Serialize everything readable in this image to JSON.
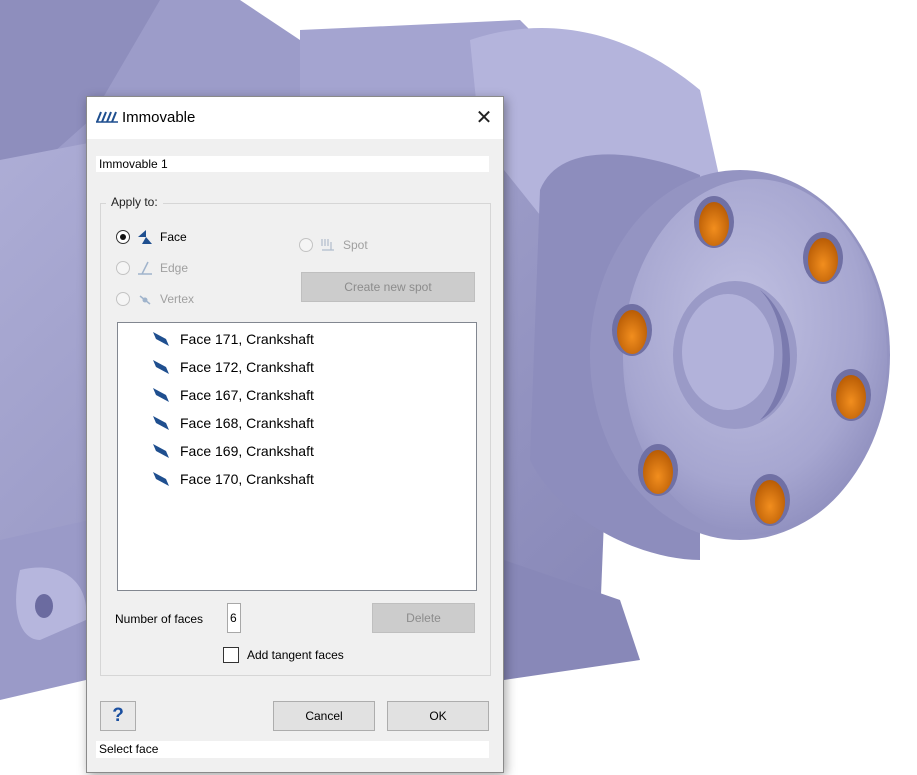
{
  "dialog": {
    "title": "Immovable",
    "close_glyph": "✕",
    "name_value": "Immovable 1",
    "apply_to": {
      "legend": "Apply to:",
      "options": [
        {
          "label": "Face",
          "checked": true,
          "enabled": true,
          "icon": "face-icon"
        },
        {
          "label": "Edge",
          "checked": false,
          "enabled": false,
          "icon": "edge-icon"
        },
        {
          "label": "Vertex",
          "checked": false,
          "enabled": false,
          "icon": "vertex-icon"
        },
        {
          "label": "Spot",
          "checked": false,
          "enabled": false,
          "icon": "spot-icon"
        }
      ],
      "create_spot_label": "Create new spot"
    },
    "faces": [
      "Face 171, Crankshaft",
      "Face 172, Crankshaft",
      "Face 167, Crankshaft",
      "Face 168, Crankshaft",
      "Face 169, Crankshaft",
      "Face 170, Crankshaft"
    ],
    "count_label": "Number of faces",
    "count_value": "6",
    "delete_label": "Delete",
    "tangent_label": "Add tangent faces",
    "tangent_checked": false,
    "help_glyph": "?",
    "cancel_label": "Cancel",
    "ok_label": "OK",
    "status_text": "Select face"
  },
  "colors": {
    "part_body": "#a9a9d2",
    "part_shadow": "#7f7fb0",
    "hole_orange": "#e0790f",
    "accent_icon": "#1f4f8f"
  }
}
